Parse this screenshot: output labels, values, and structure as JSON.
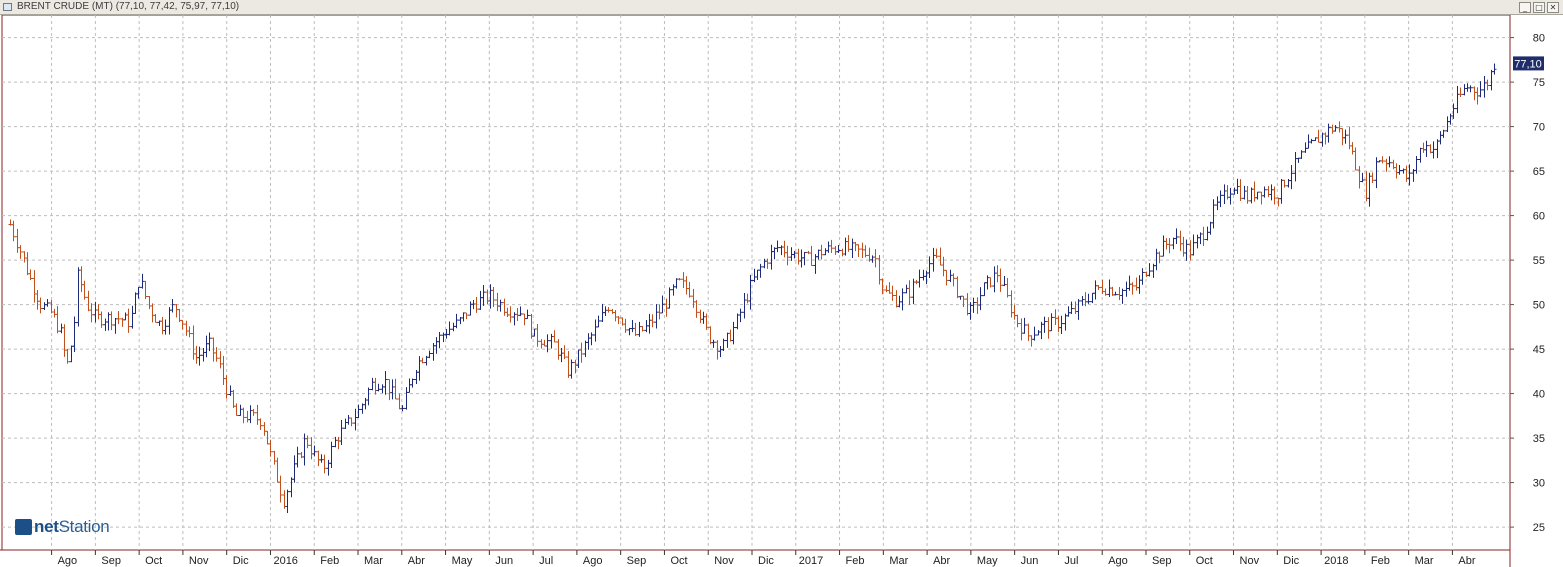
{
  "window": {
    "title": "BRENT CRUDE (MT) (77,10, 77,42, 75,97, 77,10)",
    "buttons": [
      "_",
      "□",
      "✕"
    ]
  },
  "logo": {
    "prefix": "net",
    "suffix": "Station"
  },
  "colors": {
    "up": "#1d2a7a",
    "down": "#c1501c",
    "grid": "#bdbdbd",
    "frame": "#8b2020",
    "last_price_bg": "#1f2d6b"
  },
  "chart_data": {
    "type": "ohlc",
    "title": "BRENT CRUDE (MT)",
    "last_bar": {
      "open": 77.1,
      "high": 77.42,
      "low": 75.97,
      "close": 77.1
    },
    "last_price_label": "77,10",
    "ylim": [
      22.5,
      82.5
    ],
    "y_ticks": [
      25,
      30,
      35,
      40,
      45,
      50,
      55,
      60,
      65,
      70,
      75,
      80
    ],
    "grid": true,
    "x_ticks": [
      {
        "label": "Ago",
        "x": 1.0
      },
      {
        "label": "Sep",
        "x": 2.0
      },
      {
        "label": "Oct",
        "x": 3.0
      },
      {
        "label": "Nov",
        "x": 4.0
      },
      {
        "label": "Dic",
        "x": 5.0
      },
      {
        "label": "2016",
        "x": 6.0,
        "year": true
      },
      {
        "label": "Feb",
        "x": 7.0
      },
      {
        "label": "Mar",
        "x": 8.0
      },
      {
        "label": "Abr",
        "x": 9.0
      },
      {
        "label": "May",
        "x": 10.0
      },
      {
        "label": "Jun",
        "x": 11.0
      },
      {
        "label": "Jul",
        "x": 12.0
      },
      {
        "label": "Ago",
        "x": 13.0
      },
      {
        "label": "Sep",
        "x": 14.0
      },
      {
        "label": "Oct",
        "x": 15.0
      },
      {
        "label": "Nov",
        "x": 16.0
      },
      {
        "label": "Dic",
        "x": 17.0
      },
      {
        "label": "2017",
        "x": 18.0,
        "year": true
      },
      {
        "label": "Feb",
        "x": 19.0
      },
      {
        "label": "Mar",
        "x": 20.0
      },
      {
        "label": "Abr",
        "x": 21.0
      },
      {
        "label": "May",
        "x": 22.0
      },
      {
        "label": "Jun",
        "x": 23.0
      },
      {
        "label": "Jul",
        "x": 24.0
      },
      {
        "label": "Ago",
        "x": 25.0
      },
      {
        "label": "Sep",
        "x": 26.0
      },
      {
        "label": "Oct",
        "x": 27.0
      },
      {
        "label": "Nov",
        "x": 28.0
      },
      {
        "label": "Dic",
        "x": 29.0
      },
      {
        "label": "2018",
        "x": 30.0,
        "year": true
      },
      {
        "label": "Feb",
        "x": 31.0
      },
      {
        "label": "Mar",
        "x": 32.0
      },
      {
        "label": "Abr",
        "x": 33.0
      }
    ],
    "xlim": [
      0.05,
      33.95
    ],
    "price_path": [
      [
        0.05,
        59.0
      ],
      [
        0.25,
        56.5
      ],
      [
        0.5,
        53.0
      ],
      [
        0.75,
        50.0
      ],
      [
        1.0,
        49.0
      ],
      [
        1.2,
        47.0
      ],
      [
        1.35,
        43.0
      ],
      [
        1.5,
        47.0
      ],
      [
        1.6,
        53.5
      ],
      [
        1.8,
        50.0
      ],
      [
        2.0,
        48.5
      ],
      [
        2.5,
        48.5
      ],
      [
        2.8,
        48.0
      ],
      [
        3.0,
        53.0
      ],
      [
        3.2,
        50.0
      ],
      [
        3.5,
        47.5
      ],
      [
        3.8,
        50.0
      ],
      [
        4.0,
        48.0
      ],
      [
        4.3,
        44.0
      ],
      [
        4.6,
        45.5
      ],
      [
        4.8,
        43.5
      ],
      [
        5.0,
        40.5
      ],
      [
        5.2,
        37.5
      ],
      [
        5.5,
        37.5
      ],
      [
        5.8,
        37.0
      ],
      [
        6.0,
        33.0
      ],
      [
        6.3,
        28.0
      ],
      [
        6.5,
        31.0
      ],
      [
        6.8,
        35.0
      ],
      [
        7.0,
        33.0
      ],
      [
        7.2,
        31.5
      ],
      [
        7.5,
        35.0
      ],
      [
        8.0,
        38.0
      ],
      [
        8.3,
        41.0
      ],
      [
        8.6,
        41.5
      ],
      [
        9.0,
        38.0
      ],
      [
        9.3,
        43.0
      ],
      [
        9.6,
        45.0
      ],
      [
        10.0,
        47.0
      ],
      [
        10.3,
        48.0
      ],
      [
        10.6,
        50.0
      ],
      [
        11.0,
        51.0
      ],
      [
        11.4,
        49.5
      ],
      [
        11.8,
        49.0
      ],
      [
        12.0,
        46.5
      ],
      [
        12.5,
        45.5
      ],
      [
        12.8,
        42.5
      ],
      [
        13.0,
        44.0
      ],
      [
        13.4,
        47.0
      ],
      [
        13.7,
        50.0
      ],
      [
        14.0,
        48.5
      ],
      [
        14.3,
        46.5
      ],
      [
        14.6,
        47.5
      ],
      [
        15.0,
        50.0
      ],
      [
        15.3,
        52.5
      ],
      [
        15.6,
        51.5
      ],
      [
        16.0,
        46.5
      ],
      [
        16.3,
        45.0
      ],
      [
        16.6,
        47.5
      ],
      [
        17.0,
        52.5
      ],
      [
        17.3,
        55.0
      ],
      [
        17.6,
        56.5
      ],
      [
        18.0,
        55.5
      ],
      [
        18.3,
        55.0
      ],
      [
        18.6,
        56.0
      ],
      [
        19.0,
        56.5
      ],
      [
        19.4,
        56.0
      ],
      [
        19.8,
        55.5
      ],
      [
        20.0,
        51.5
      ],
      [
        20.3,
        50.5
      ],
      [
        20.6,
        51.5
      ],
      [
        21.0,
        54.5
      ],
      [
        21.2,
        55.0
      ],
      [
        21.5,
        53.0
      ],
      [
        21.8,
        50.5
      ],
      [
        22.0,
        49.0
      ],
      [
        22.3,
        52.0
      ],
      [
        22.6,
        53.5
      ],
      [
        23.0,
        48.5
      ],
      [
        23.3,
        46.5
      ],
      [
        23.6,
        47.5
      ],
      [
        24.0,
        48.0
      ],
      [
        24.4,
        49.5
      ],
      [
        24.8,
        51.5
      ],
      [
        25.0,
        52.0
      ],
      [
        25.4,
        51.5
      ],
      [
        25.8,
        52.0
      ],
      [
        26.0,
        54.0
      ],
      [
        26.3,
        56.0
      ],
      [
        26.6,
        57.5
      ],
      [
        27.0,
        56.0
      ],
      [
        27.3,
        58.0
      ],
      [
        27.6,
        61.0
      ],
      [
        28.0,
        63.5
      ],
      [
        28.3,
        62.0
      ],
      [
        28.6,
        63.0
      ],
      [
        29.0,
        62.5
      ],
      [
        29.3,
        65.0
      ],
      [
        29.6,
        67.0
      ],
      [
        30.0,
        69.0
      ],
      [
        30.3,
        70.0
      ],
      [
        30.6,
        68.5
      ],
      [
        30.9,
        64.0
      ],
      [
        31.0,
        62.5
      ],
      [
        31.3,
        66.5
      ],
      [
        31.6,
        66.0
      ],
      [
        31.9,
        64.5
      ],
      [
        32.0,
        64.0
      ],
      [
        32.3,
        68.0
      ],
      [
        32.6,
        67.5
      ],
      [
        33.0,
        72.0
      ],
      [
        33.3,
        74.5
      ],
      [
        33.6,
        74.0
      ],
      [
        33.8,
        75.0
      ],
      [
        33.95,
        77.1
      ]
    ]
  }
}
